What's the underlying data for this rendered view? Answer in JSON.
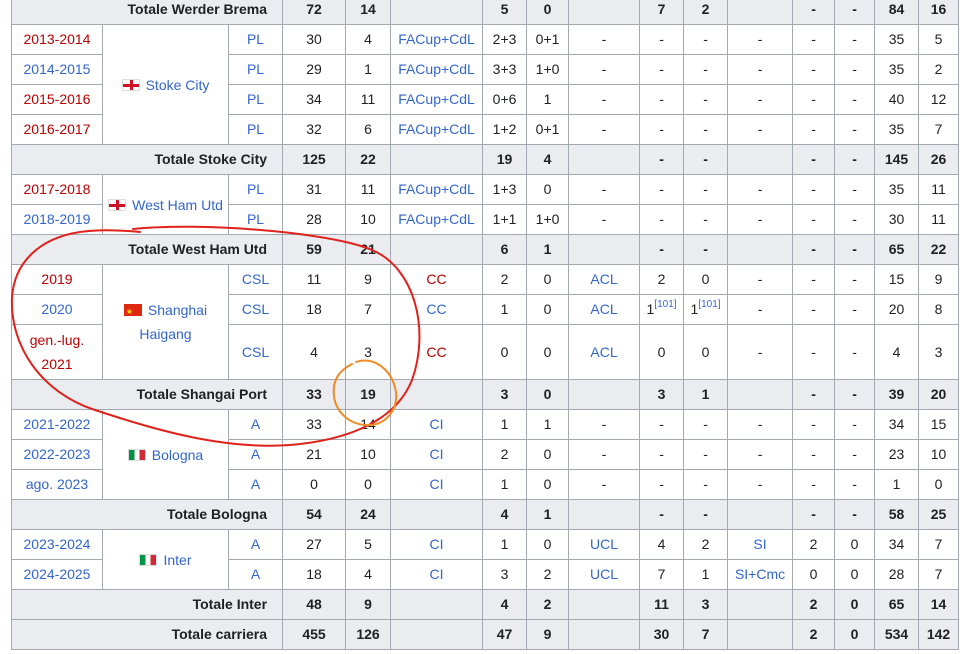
{
  "rows": {
    "r0": [
      "Totale Werder Brema",
      "72",
      "14",
      "5",
      "0",
      "7",
      "2",
      "-",
      "-",
      "84",
      "16"
    ],
    "r1": [
      "2013-2014",
      "PL",
      "30",
      "4",
      "FACup+CdL",
      "2+3",
      "0+1",
      "-",
      "-",
      "-",
      "-",
      "-",
      "-",
      "35",
      "5"
    ],
    "r2": [
      "2014-2015",
      "PL",
      "29",
      "1",
      "FACup+CdL",
      "3+3",
      "1+0",
      "-",
      "-",
      "-",
      "-",
      "-",
      "-",
      "35",
      "2"
    ],
    "r3": [
      "2015-2016",
      "PL",
      "34",
      "11",
      "FACup+CdL",
      "0+6",
      "1",
      "-",
      "-",
      "-",
      "-",
      "-",
      "-",
      "40",
      "12"
    ],
    "r4": [
      "2016-2017",
      "PL",
      "32",
      "6",
      "FACup+CdL",
      "1+2",
      "0+1",
      "-",
      "-",
      "-",
      "-",
      "-",
      "-",
      "35",
      "7"
    ],
    "r5": [
      "Totale Stoke City",
      "125",
      "22",
      "19",
      "4",
      "-",
      "-",
      "-",
      "-",
      "145",
      "26"
    ],
    "r6": [
      "2017-2018",
      "PL",
      "31",
      "11",
      "FACup+CdL",
      "1+3",
      "0",
      "-",
      "-",
      "-",
      "-",
      "-",
      "-",
      "35",
      "11"
    ],
    "r7": [
      "2018-2019",
      "PL",
      "28",
      "10",
      "FACup+CdL",
      "1+1",
      "1+0",
      "-",
      "-",
      "-",
      "-",
      "-",
      "-",
      "30",
      "11"
    ],
    "r8": [
      "Totale West Ham Utd",
      "59",
      "21",
      "6",
      "1",
      "-",
      "-",
      "-",
      "-",
      "65",
      "22"
    ],
    "r9": [
      "2019",
      "CSL",
      "11",
      "9",
      "CC",
      "2",
      "0",
      "ACL",
      "2",
      "0",
      "-",
      "-",
      "-",
      "15",
      "9"
    ],
    "r10": [
      "2020",
      "CSL",
      "18",
      "7",
      "CC",
      "1",
      "0",
      "ACL",
      "1",
      "1",
      "-",
      "-",
      "-",
      "20",
      "8"
    ],
    "r11": [
      "gen.-lug. 2021",
      "CSL",
      "4",
      "3",
      "CC",
      "0",
      "0",
      "ACL",
      "0",
      "0",
      "-",
      "-",
      "-",
      "4",
      "3"
    ],
    "r12": [
      "Totale Shangai Port",
      "33",
      "19",
      "3",
      "0",
      "3",
      "1",
      "-",
      "-",
      "39",
      "20"
    ],
    "r13": [
      "2021-2022",
      "A",
      "33",
      "14",
      "CI",
      "1",
      "1",
      "-",
      "-",
      "-",
      "-",
      "-",
      "-",
      "34",
      "15"
    ],
    "r14": [
      "2022-2023",
      "A",
      "21",
      "10",
      "CI",
      "2",
      "0",
      "-",
      "-",
      "-",
      "-",
      "-",
      "-",
      "23",
      "10"
    ],
    "r15": [
      "ago. 2023",
      "A",
      "0",
      "0",
      "CI",
      "1",
      "0",
      "-",
      "-",
      "-",
      "-",
      "-",
      "-",
      "1",
      "0"
    ],
    "r16": [
      "Totale Bologna",
      "54",
      "24",
      "4",
      "1",
      "-",
      "-",
      "-",
      "-",
      "58",
      "25"
    ],
    "r17": [
      "2023-2024",
      "A",
      "27",
      "5",
      "CI",
      "1",
      "0",
      "UCL",
      "4",
      "2",
      "SI",
      "2",
      "0",
      "34",
      "7"
    ],
    "r18": [
      "2024-2025",
      "A",
      "18",
      "4",
      "CI",
      "3",
      "2",
      "UCL",
      "7",
      "1",
      "SI+Cmc",
      "0",
      "0",
      "28",
      "7"
    ],
    "r19": [
      "Totale Inter",
      "48",
      "9",
      "4",
      "2",
      "11",
      "3",
      "2",
      "0",
      "65",
      "14"
    ],
    "r20": [
      "Totale carriera",
      "455",
      "126",
      "47",
      "9",
      "30",
      "7",
      "2",
      "0",
      "534",
      "142"
    ]
  },
  "clubs": {
    "stoke": "Stoke City",
    "westham": "West Ham Utd",
    "shanghai": "Shanghai Haigang",
    "bologna": "Bologna",
    "inter": "Inter"
  },
  "refs": {
    "ref101a": "[101]",
    "ref101b": "[101]"
  },
  "flags": {
    "stoke": "england",
    "westham": "england",
    "shanghai": "china",
    "bologna": "italy",
    "inter": "italy"
  },
  "annotations": {
    "red_loop_color": "#e0221c",
    "orange_circle_color": "#f08a24"
  }
}
